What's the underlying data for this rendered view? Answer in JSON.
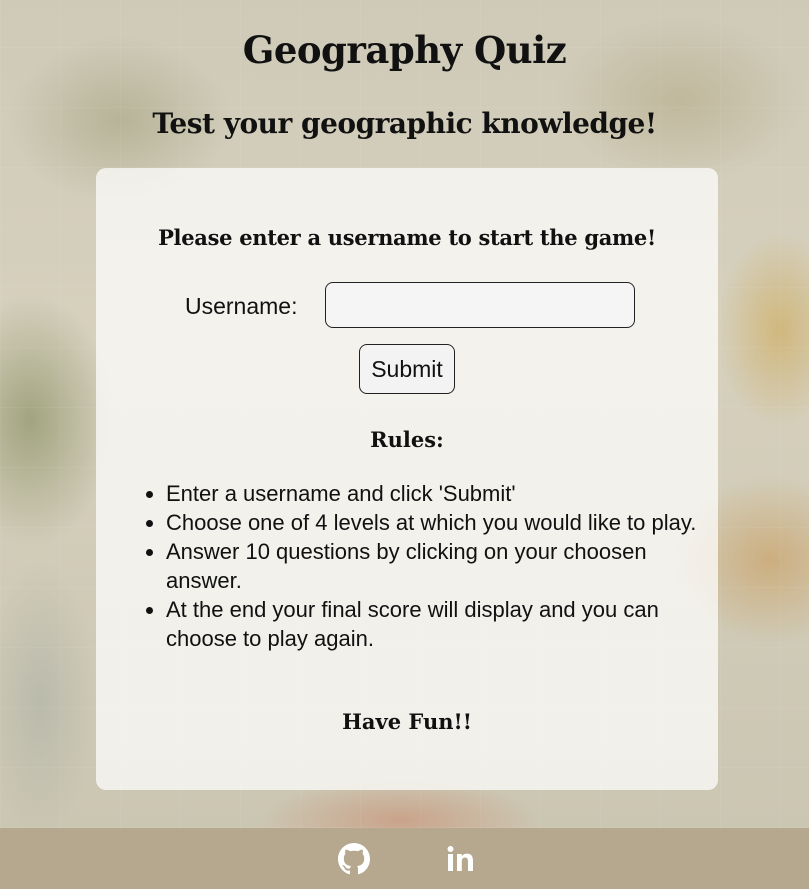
{
  "header": {
    "title": "Geography Quiz",
    "subtitle": "Test your geographic knowledge!"
  },
  "form": {
    "prompt": "Please enter a username to start the game!",
    "username_label": "Username:",
    "username_value": "",
    "username_placeholder": "",
    "submit_label": "Submit"
  },
  "rules": {
    "title": "Rules:",
    "items": [
      "Enter a username and click 'Submit'",
      "Choose one of 4 levels at which you would like to play.",
      "Answer 10 questions by clicking on your choosen answer.",
      "At the end your final score will display and you can choose to play again."
    ],
    "closing": "Have Fun!!"
  },
  "footer": {
    "links": [
      {
        "icon": "github-icon"
      },
      {
        "icon": "linkedin-icon"
      }
    ]
  },
  "colors": {
    "footer_bg": "#b5a88f",
    "card_bg": "rgba(255,255,255,0.72)",
    "text": "#111111"
  }
}
